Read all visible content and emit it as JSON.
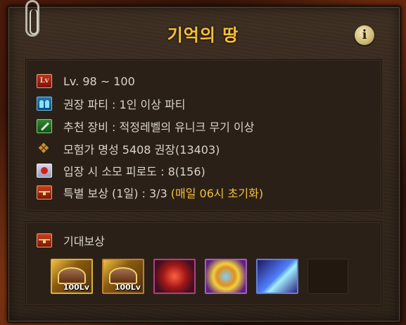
{
  "dialog": {
    "title": "기억의 땅",
    "info_icon": "i"
  },
  "info": {
    "level_icon": "Lv",
    "level": "Lv. 98 ~ 100",
    "party": "권장 파티 : 1인 이상 파티",
    "equipment": "추천 장비 : 적정레벨의 유니크 무기 이상",
    "fame": "모험가 명성 5408 권장(13403)",
    "fatigue": "입장 시 소모 피로도 : 8(156)",
    "reward_prefix": "특별 보상 (1일) : 3/3 ",
    "reward_reset": "(매일 06시 초기화)"
  },
  "rewards": {
    "label": "기대보상",
    "items": [
      {
        "name": "helmet-100-box",
        "level": "100Lv"
      },
      {
        "name": "helmet-100-box-2",
        "level": "100Lv"
      },
      {
        "name": "red-crystal"
      },
      {
        "name": "golden-orb"
      },
      {
        "name": "spear-weapon"
      },
      {
        "name": "empty-slot"
      }
    ]
  },
  "colors": {
    "title": "#f3c23a",
    "highlight": "#f3c23a",
    "text": "#d9d4cc",
    "panel": "#3e2f22"
  }
}
